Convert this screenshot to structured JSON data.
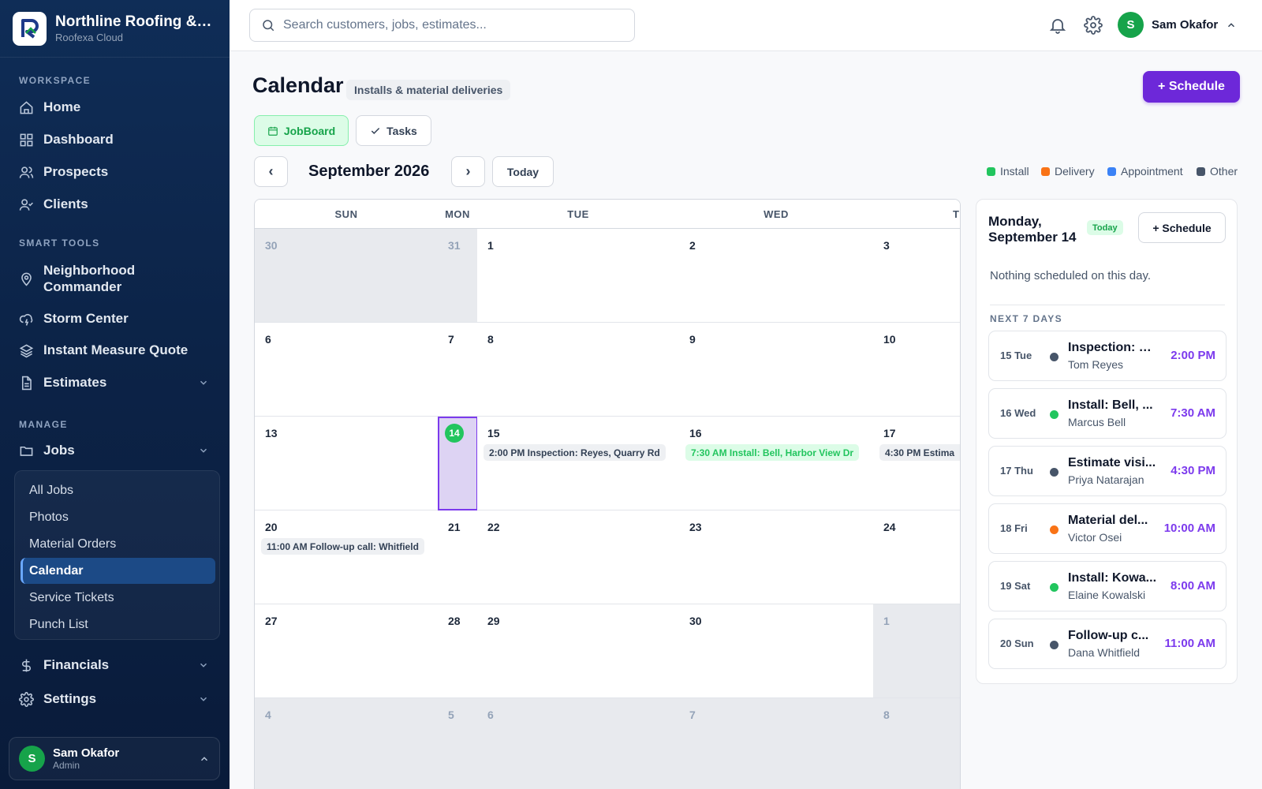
{
  "brand": {
    "name": "Northline Roofing & Ex...",
    "sub": "Roofexa Cloud"
  },
  "sidebar": {
    "sections": {
      "workspace": "WORKSPACE",
      "smart_tools": "SMART TOOLS",
      "manage": "MANAGE"
    },
    "items": {
      "home": "Home",
      "dashboard": "Dashboard",
      "prospects": "Prospects",
      "clients": "Clients",
      "neighborhood_line1": "Neighborhood",
      "neighborhood_line2": "Commander",
      "storm": "Storm Center",
      "instant": "Instant Measure Quote",
      "estimates": "Estimates",
      "jobs": "Jobs",
      "financials": "Financials",
      "settings": "Settings"
    },
    "jobs_sub": [
      "All Jobs",
      "Photos",
      "Material Orders",
      "Calendar",
      "Service Tickets",
      "Punch List"
    ],
    "user": {
      "name": "Sam Okafor",
      "role": "Admin",
      "initial": "S"
    }
  },
  "topbar": {
    "search_placeholder": "Search customers, jobs, estimates...",
    "user_name": "Sam Okafor",
    "user_initial": "S"
  },
  "page": {
    "title": "Calendar",
    "subtitle": "Installs & material deliveries",
    "schedule_label": "+ Schedule",
    "tabs": {
      "jobboard": "JobBoard",
      "tasks": "Tasks"
    },
    "prev": "‹",
    "next": "›",
    "today": "Today",
    "month": "September 2026"
  },
  "legend": {
    "install": "Install",
    "delivery": "Delivery",
    "appointment": "Appointment",
    "other": "Other"
  },
  "colors": {
    "install": "#22c55e",
    "delivery": "#f97316",
    "appointment": "#3b82f6",
    "other": "#475569",
    "accent": "#6d28d9"
  },
  "calendar": {
    "headers": {
      "sun": "SUN",
      "mon": "MON",
      "tue": "TUE",
      "wed": "WED",
      "thu": "T"
    },
    "rows": [
      [
        "30",
        "31",
        "1",
        "2",
        "3"
      ],
      [
        "6",
        "7",
        "8",
        "9",
        "10"
      ],
      [
        "13",
        "14",
        "15",
        "16",
        "17"
      ],
      [
        "20",
        "21",
        "22",
        "23",
        "24"
      ],
      [
        "27",
        "28",
        "29",
        "30",
        "1"
      ],
      [
        "4",
        "5",
        "6",
        "7",
        "8"
      ]
    ],
    "events": {
      "sep15": "2:00 PM Inspection: Reyes, Quarry Rd",
      "sep16": "7:30 AM Install: Bell, Harbor View Dr",
      "sep17": "4:30 PM Estima",
      "sep20": "11:00 AM Follow-up call: Whitfield"
    }
  },
  "panel": {
    "title": "Monday, September 14",
    "today_badge": "Today",
    "schedule_label": "+ Schedule",
    "empty": "Nothing scheduled on this day.",
    "next_label": "NEXT 7 DAYS",
    "upcoming": [
      {
        "day": "15 Tue",
        "title": "Inspection: R...",
        "who": "Tom Reyes",
        "time": "2:00 PM"
      },
      {
        "day": "16 Wed",
        "title": "Install: Bell, ...",
        "who": "Marcus Bell",
        "time": "7:30 AM"
      },
      {
        "day": "17 Thu",
        "title": "Estimate visi...",
        "who": "Priya Natarajan",
        "time": "4:30 PM"
      },
      {
        "day": "18 Fri",
        "title": "Material del...",
        "who": "Victor Osei",
        "time": "10:00 AM"
      },
      {
        "day": "19 Sat",
        "title": "Install: Kowa...",
        "who": "Elaine Kowalski",
        "time": "8:00 AM"
      },
      {
        "day": "20 Sun",
        "title": "Follow-up c...",
        "who": "Dana Whitfield",
        "time": "11:00 AM"
      }
    ]
  }
}
